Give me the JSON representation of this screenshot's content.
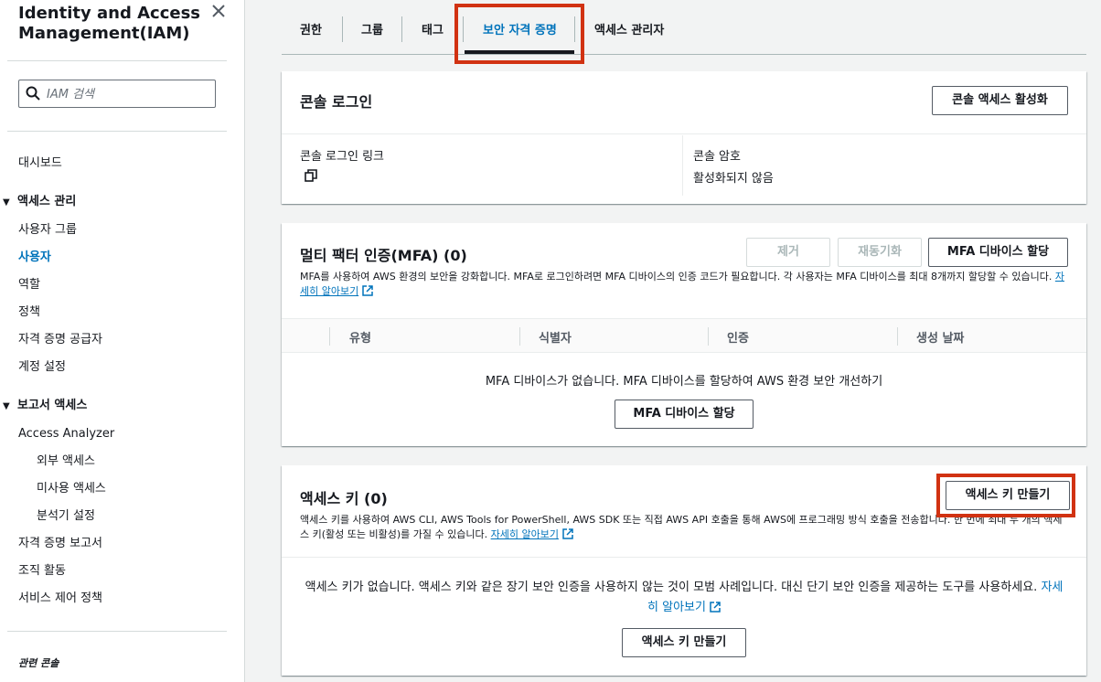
{
  "sidebar": {
    "title": "Identity and Access Management(IAM)",
    "search_placeholder": "IAM 검색",
    "dashboard": "대시보드",
    "access_mgmt": {
      "label": "액세스 관리",
      "items": [
        "사용자 그룹",
        "사용자",
        "역할",
        "정책",
        "자격 증명 공급자",
        "계정 설정"
      ]
    },
    "reports": {
      "label": "보고서 액세스",
      "analyzer": "Access Analyzer",
      "analyzer_items": [
        "외부 액세스",
        "미사용 액세스",
        "분석기 설정"
      ],
      "items": [
        "자격 증명 보고서",
        "조직 활동",
        "서비스 제어 정책"
      ]
    },
    "related": "관련 콘솔"
  },
  "tabs": [
    "권한",
    "그룹",
    "태그",
    "보안 자격 증명",
    "액세스 관리자"
  ],
  "active_tab": "보안 자격 증명",
  "console_signin": {
    "title": "콘솔 로그인",
    "enable_button": "콘솔 액세스 활성화",
    "link_label": "콘솔 로그인 링크",
    "password_label": "콘솔 암호",
    "password_value": "활성화되지 않음"
  },
  "mfa": {
    "title": "멀티 팩터 인증(MFA) (0)",
    "remove_button": "제거",
    "resync_button": "재동기화",
    "assign_button": "MFA 디바이스 할당",
    "description": "MFA를 사용하여 AWS 환경의 보안을 강화합니다. MFA로 로그인하려면 MFA 디바이스의 인증 코드가 필요합니다. 각 사용자는 MFA 디바이스를 최대 8개까지 할당할 수 있습니다.",
    "learn_more": "자세히 알아보기",
    "columns": [
      "유형",
      "식별자",
      "인증",
      "생성 날짜"
    ],
    "empty_text": "MFA 디바이스가 없습니다. MFA 디바이스를 할당하여 AWS 환경 보안 개선하기",
    "empty_button": "MFA 디바이스 할당"
  },
  "access_keys": {
    "title": "액세스 키 (0)",
    "create_button": "액세스 키 만들기",
    "description": "액세스 키를 사용하여 AWS CLI, AWS Tools for PowerShell, AWS SDK 또는 직접 AWS API 호출을 통해 AWS에 프로그래밍 방식 호출을 전송합니다. 한 번에 최대 두 개의 액세스 키(활성 또는 비활성)를 가질 수 있습니다.",
    "learn_more": "자세히 알아보기",
    "empty_text": "액세스 키가 없습니다. 액세스 키와 같은 장기 보안 인증을 사용하지 않는 것이 모범 사례입니다. 대신 단기 보안 인증을 제공하는 도구를 사용하세요.",
    "empty_learn_more": "자세히 알아보기",
    "empty_button": "액세스 키 만들기"
  },
  "colors": {
    "accent": "#0073bb",
    "highlight": "#d13212",
    "text": "#16191f"
  }
}
